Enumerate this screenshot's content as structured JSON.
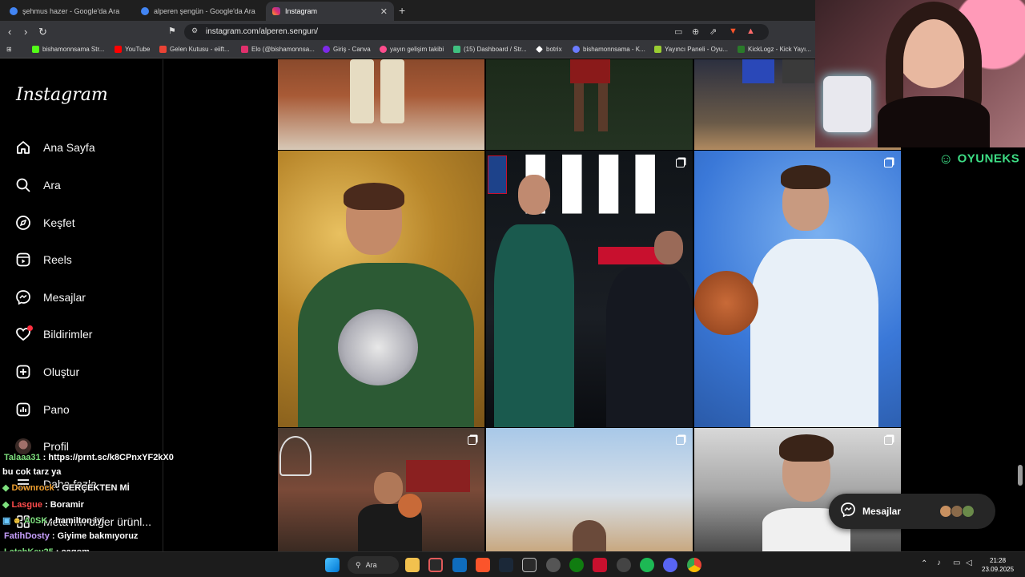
{
  "browser": {
    "tabs": [
      {
        "label": "şehmus hazer - Google'da Ara",
        "active": false
      },
      {
        "label": "alperen şengün - Google'da Ara",
        "active": false
      },
      {
        "label": "Instagram",
        "active": true
      }
    ],
    "url": "instagram.com/alperen.sengun/",
    "bookmarks": [
      "bishamonnsama Str...",
      "YouTube",
      "Gelen Kutusu - eiift...",
      "Elo (@bishamonnsa...",
      "Giriş - Canva",
      "yayın gelişim takibi",
      "(15) Dashboard / Str...",
      "botrix",
      "bishamonnsama - K...",
      "Yayıncı Paneli - Oyu...",
      "KickLogz - Kick Yayı..."
    ]
  },
  "instagram": {
    "logo": "Instagram",
    "nav": [
      {
        "label": "Ana Sayfa",
        "icon": "home-icon"
      },
      {
        "label": "Ara",
        "icon": "search-icon"
      },
      {
        "label": "Keşfet",
        "icon": "compass-icon"
      },
      {
        "label": "Reels",
        "icon": "reels-icon"
      },
      {
        "label": "Mesajlar",
        "icon": "messenger-icon"
      },
      {
        "label": "Bildirimler",
        "icon": "heart-icon"
      },
      {
        "label": "Oluştur",
        "icon": "plus-icon"
      },
      {
        "label": "Pano",
        "icon": "dashboard-icon"
      },
      {
        "label": "Profil",
        "icon": "avatar-icon"
      },
      {
        "label": "Daha fazla",
        "icon": "menu-icon"
      },
      {
        "label": "Meta'nın diğer ürünl...",
        "icon": "meta-icon"
      }
    ],
    "messages_pill": {
      "label": "Mesajlar"
    }
  },
  "overlay": {
    "brand": "OYUNEKS"
  },
  "chat": [
    {
      "user": "Talaaa31",
      "message": ": https://prnt.sc/k8CPnxYF2kX0",
      "color": "#7ee07e"
    },
    {
      "user": "",
      "message": "bu cok tarz ya",
      "color": "#ffffff"
    },
    {
      "user": "Downrock",
      "message": ": GERÇEKTEN Mİ",
      "color": "#f0a030"
    },
    {
      "user": "Lasgue",
      "message": ": Boramir",
      "color": "#ff4b4b"
    },
    {
      "user": "A0SK",
      "message": ": hamilton iyi",
      "color": "#7ee07e"
    },
    {
      "user": "FatihDosty",
      "message": ": Giyime bakmıyoruz",
      "color": "#c9a0ff"
    },
    {
      "user": "LatchKey25",
      "message": ": cagom",
      "color": "#7ee07e"
    }
  ],
  "taskbar": {
    "search": "Ara",
    "time": "21:28",
    "date": "23.09.2025"
  }
}
